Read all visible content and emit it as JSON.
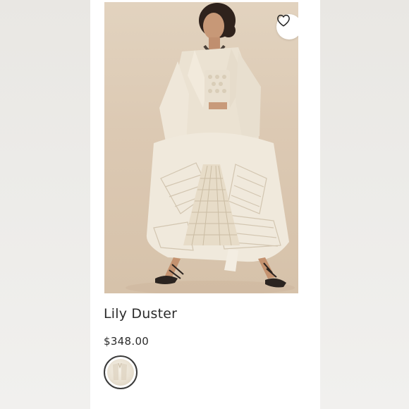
{
  "product": {
    "name": "Lily Duster",
    "price": "$348.00",
    "favorite_icon": "heart-outline-icon",
    "swatches": [
      {
        "name": "ivory",
        "color": "#ece4d4",
        "selected": true
      }
    ]
  },
  "colors": {
    "background": "#efeeec",
    "card": "#ffffff",
    "photo_backdrop": "#dccab4",
    "garment": "#eee6d8",
    "text": "#2b2b2b"
  }
}
